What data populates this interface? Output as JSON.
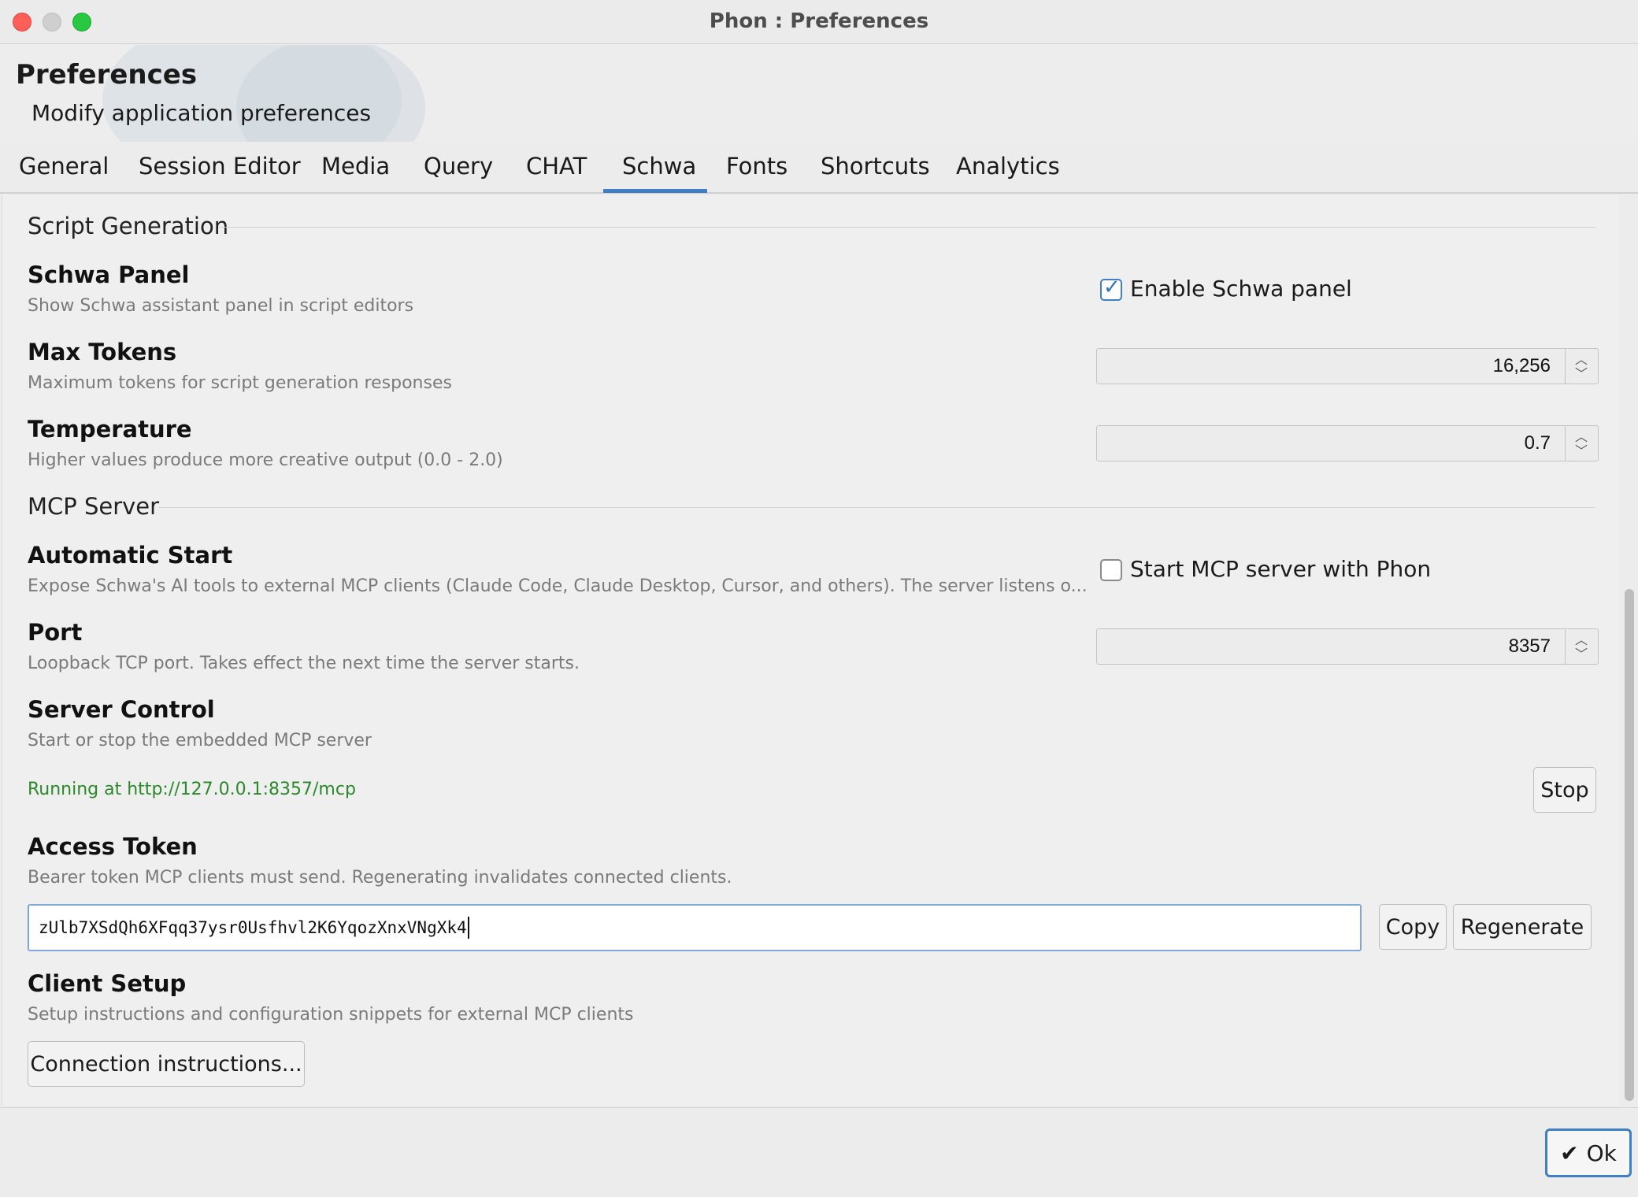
{
  "window": {
    "title": "Phon : Preferences"
  },
  "header": {
    "title": "Preferences",
    "subtitle": "Modify application preferences"
  },
  "tabs": [
    {
      "label": "General"
    },
    {
      "label": "Session Editor"
    },
    {
      "label": "Media"
    },
    {
      "label": "Query"
    },
    {
      "label": "CHAT"
    },
    {
      "label": "Schwa",
      "active": true
    },
    {
      "label": "Fonts"
    },
    {
      "label": "Shortcuts"
    },
    {
      "label": "Analytics"
    }
  ],
  "script_generation": {
    "section_title": "Script Generation",
    "schwa_panel": {
      "label": "Schwa Panel",
      "description": "Show Schwa assistant panel in script editors",
      "checkbox_label": "Enable Schwa panel",
      "checked": true
    },
    "max_tokens": {
      "label": "Max Tokens",
      "description": "Maximum tokens for script generation responses",
      "value": "16,256"
    },
    "temperature": {
      "label": "Temperature",
      "description": "Higher values produce more creative output (0.0 - 2.0)",
      "value": "0.7"
    }
  },
  "mcp_server": {
    "section_title": "MCP Server",
    "automatic_start": {
      "label": "Automatic Start",
      "description": "Expose Schwa's AI tools to external MCP clients (Claude Code, Claude Desktop, Cursor, and others). The server listens o...",
      "checkbox_label": "Start MCP server with Phon",
      "checked": false
    },
    "port": {
      "label": "Port",
      "description": "Loopback TCP port. Takes effect the next time the server starts.",
      "value": "8357"
    },
    "server_control": {
      "label": "Server Control",
      "description": "Start or stop the embedded MCP server",
      "status": "Running at http://127.0.0.1:8357/mcp",
      "stop_label": "Stop"
    },
    "access_token": {
      "label": "Access Token",
      "description": "Bearer token MCP clients must send. Regenerating invalidates connected clients.",
      "value": "zUlb7XSdQh6XFqq37ysr0Usfhvl2K6YqozXnxVNgXk4",
      "copy_label": "Copy",
      "regenerate_label": "Regenerate"
    },
    "client_setup": {
      "label": "Client Setup",
      "description": "Setup instructions and configuration snippets for external MCP clients",
      "button_label": "Connection instructions..."
    }
  },
  "footer": {
    "ok_label": "Ok"
  },
  "colors": {
    "accent": "#3f7fc4",
    "status_green": "#2a8a2a"
  }
}
